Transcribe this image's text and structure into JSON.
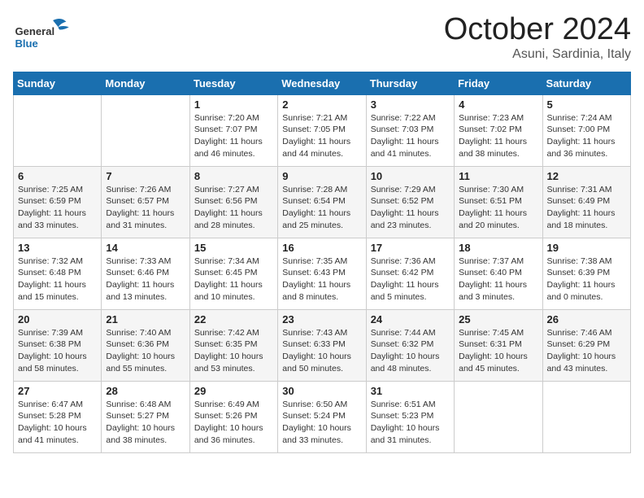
{
  "header": {
    "logo_general": "General",
    "logo_blue": "Blue",
    "month_title": "October 2024",
    "location": "Asuni, Sardinia, Italy"
  },
  "weekdays": [
    "Sunday",
    "Monday",
    "Tuesday",
    "Wednesday",
    "Thursday",
    "Friday",
    "Saturday"
  ],
  "weeks": [
    [
      {
        "day": "",
        "detail": ""
      },
      {
        "day": "",
        "detail": ""
      },
      {
        "day": "1",
        "detail": "Sunrise: 7:20 AM\nSunset: 7:07 PM\nDaylight: 11 hours and 46 minutes."
      },
      {
        "day": "2",
        "detail": "Sunrise: 7:21 AM\nSunset: 7:05 PM\nDaylight: 11 hours and 44 minutes."
      },
      {
        "day": "3",
        "detail": "Sunrise: 7:22 AM\nSunset: 7:03 PM\nDaylight: 11 hours and 41 minutes."
      },
      {
        "day": "4",
        "detail": "Sunrise: 7:23 AM\nSunset: 7:02 PM\nDaylight: 11 hours and 38 minutes."
      },
      {
        "day": "5",
        "detail": "Sunrise: 7:24 AM\nSunset: 7:00 PM\nDaylight: 11 hours and 36 minutes."
      }
    ],
    [
      {
        "day": "6",
        "detail": "Sunrise: 7:25 AM\nSunset: 6:59 PM\nDaylight: 11 hours and 33 minutes."
      },
      {
        "day": "7",
        "detail": "Sunrise: 7:26 AM\nSunset: 6:57 PM\nDaylight: 11 hours and 31 minutes."
      },
      {
        "day": "8",
        "detail": "Sunrise: 7:27 AM\nSunset: 6:56 PM\nDaylight: 11 hours and 28 minutes."
      },
      {
        "day": "9",
        "detail": "Sunrise: 7:28 AM\nSunset: 6:54 PM\nDaylight: 11 hours and 25 minutes."
      },
      {
        "day": "10",
        "detail": "Sunrise: 7:29 AM\nSunset: 6:52 PM\nDaylight: 11 hours and 23 minutes."
      },
      {
        "day": "11",
        "detail": "Sunrise: 7:30 AM\nSunset: 6:51 PM\nDaylight: 11 hours and 20 minutes."
      },
      {
        "day": "12",
        "detail": "Sunrise: 7:31 AM\nSunset: 6:49 PM\nDaylight: 11 hours and 18 minutes."
      }
    ],
    [
      {
        "day": "13",
        "detail": "Sunrise: 7:32 AM\nSunset: 6:48 PM\nDaylight: 11 hours and 15 minutes."
      },
      {
        "day": "14",
        "detail": "Sunrise: 7:33 AM\nSunset: 6:46 PM\nDaylight: 11 hours and 13 minutes."
      },
      {
        "day": "15",
        "detail": "Sunrise: 7:34 AM\nSunset: 6:45 PM\nDaylight: 11 hours and 10 minutes."
      },
      {
        "day": "16",
        "detail": "Sunrise: 7:35 AM\nSunset: 6:43 PM\nDaylight: 11 hours and 8 minutes."
      },
      {
        "day": "17",
        "detail": "Sunrise: 7:36 AM\nSunset: 6:42 PM\nDaylight: 11 hours and 5 minutes."
      },
      {
        "day": "18",
        "detail": "Sunrise: 7:37 AM\nSunset: 6:40 PM\nDaylight: 11 hours and 3 minutes."
      },
      {
        "day": "19",
        "detail": "Sunrise: 7:38 AM\nSunset: 6:39 PM\nDaylight: 11 hours and 0 minutes."
      }
    ],
    [
      {
        "day": "20",
        "detail": "Sunrise: 7:39 AM\nSunset: 6:38 PM\nDaylight: 10 hours and 58 minutes."
      },
      {
        "day": "21",
        "detail": "Sunrise: 7:40 AM\nSunset: 6:36 PM\nDaylight: 10 hours and 55 minutes."
      },
      {
        "day": "22",
        "detail": "Sunrise: 7:42 AM\nSunset: 6:35 PM\nDaylight: 10 hours and 53 minutes."
      },
      {
        "day": "23",
        "detail": "Sunrise: 7:43 AM\nSunset: 6:33 PM\nDaylight: 10 hours and 50 minutes."
      },
      {
        "day": "24",
        "detail": "Sunrise: 7:44 AM\nSunset: 6:32 PM\nDaylight: 10 hours and 48 minutes."
      },
      {
        "day": "25",
        "detail": "Sunrise: 7:45 AM\nSunset: 6:31 PM\nDaylight: 10 hours and 45 minutes."
      },
      {
        "day": "26",
        "detail": "Sunrise: 7:46 AM\nSunset: 6:29 PM\nDaylight: 10 hours and 43 minutes."
      }
    ],
    [
      {
        "day": "27",
        "detail": "Sunrise: 6:47 AM\nSunset: 5:28 PM\nDaylight: 10 hours and 41 minutes."
      },
      {
        "day": "28",
        "detail": "Sunrise: 6:48 AM\nSunset: 5:27 PM\nDaylight: 10 hours and 38 minutes."
      },
      {
        "day": "29",
        "detail": "Sunrise: 6:49 AM\nSunset: 5:26 PM\nDaylight: 10 hours and 36 minutes."
      },
      {
        "day": "30",
        "detail": "Sunrise: 6:50 AM\nSunset: 5:24 PM\nDaylight: 10 hours and 33 minutes."
      },
      {
        "day": "31",
        "detail": "Sunrise: 6:51 AM\nSunset: 5:23 PM\nDaylight: 10 hours and 31 minutes."
      },
      {
        "day": "",
        "detail": ""
      },
      {
        "day": "",
        "detail": ""
      }
    ]
  ]
}
